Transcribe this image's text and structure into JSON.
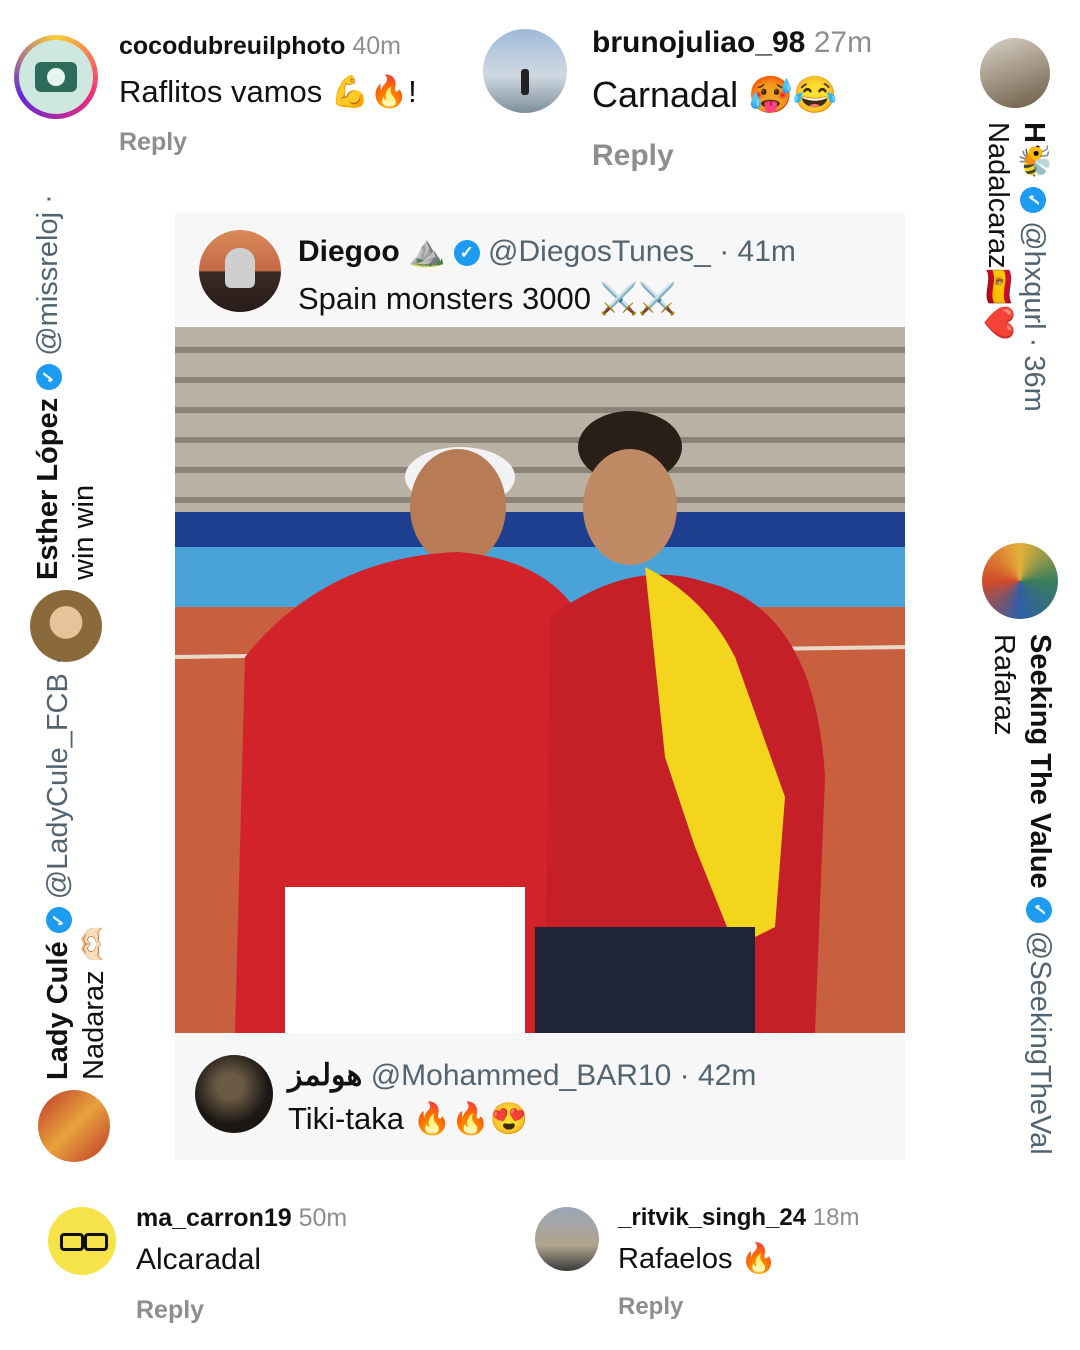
{
  "comments": [
    {
      "username": "cocodubreuilphoto",
      "time": "40m",
      "text": "Raflitos vamos 💪🔥!",
      "reply": "Reply"
    },
    {
      "username": "brunojuliao_98",
      "time": "27m",
      "text": "Carnadal 🥵😂",
      "reply": "Reply"
    },
    {
      "username": "ma_carron19",
      "time": "50m",
      "text": "Alcaradal",
      "reply": "Reply"
    },
    {
      "username": "_ritvik_singh_24",
      "time": "18m",
      "text": "Rafaelos 🔥",
      "reply": "Reply"
    }
  ],
  "tweet": {
    "name": "Diegoo ⛰️",
    "handle": "@DiegosTunes_",
    "time": "· 41m",
    "text": "Spain monsters 3000 ⚔️⚔️",
    "photo_alt": "photo",
    "reply": {
      "name": "هولمز",
      "handle": "@Mohammed_BAR10",
      "time": "· 42m",
      "text": "Tiki-taka 🔥🔥😍"
    }
  },
  "left_side": [
    {
      "name": "Esther López",
      "handle": "@missreloj ·",
      "text": "win win"
    },
    {
      "name": "Lady Culé",
      "handle": "@LadyCule_FCB ·",
      "text": "Nadaraz 🫶🏻"
    }
  ],
  "right_side": [
    {
      "name": "H🐝",
      "handle": "@hxqurl · 36m",
      "text": "Nadalcaraz🇪🇸❤️"
    },
    {
      "name": "Seeking The Value",
      "handle": "@SeekingTheVal",
      "text": "Rafaraz"
    }
  ],
  "colors": {
    "verified": "#1d9bf0",
    "muted": "#8e8e8e",
    "card_bg": "#f7f7f7",
    "clay": "#c8603f"
  },
  "icons": {
    "verified": "verified-badge-icon"
  }
}
